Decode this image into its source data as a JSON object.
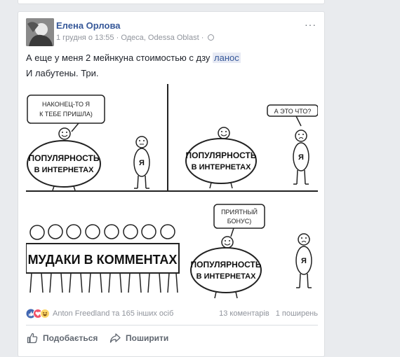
{
  "post": {
    "author": "Елена Орлова",
    "timestamp": "1 грудня о 13:55",
    "location": "Одеса, Odessa Oblast",
    "text_line1": "А еще у меня 2 мейнкуна стоимостью с дзу",
    "text_link": "ланос",
    "text_line2": "И лабутены. Три.",
    "more": "···"
  },
  "comic": {
    "panel1_speech": [
      "НАКОНЕЦ-ТО Я",
      "К ТЕБЕ ПРИШЛА)"
    ],
    "panel2_speech": "А ЭТО ЧТО?",
    "panel4_speech": [
      "ПРИЯТНЫЙ",
      "БОНУС)"
    ],
    "popularity": [
      "ПОПУЛЯРНОСТЬ",
      "В ИНТЕРНЕТАХ"
    ],
    "me": "Я",
    "mudaki": "МУДАКИ В КОММЕНТАХ"
  },
  "reactions": {
    "icons": [
      "like-icon",
      "love-icon",
      "haha-icon"
    ],
    "names": "Anton Freedland та 165 інших осіб",
    "comments": "13 коментарів",
    "shares": "1 поширень"
  },
  "actions": {
    "like": "Подобається",
    "share": "Поширити"
  },
  "colors": {
    "link": "#365899",
    "like_blue": "#4267b2",
    "love_red": "#f25268",
    "haha_yellow": "#fcd669"
  }
}
